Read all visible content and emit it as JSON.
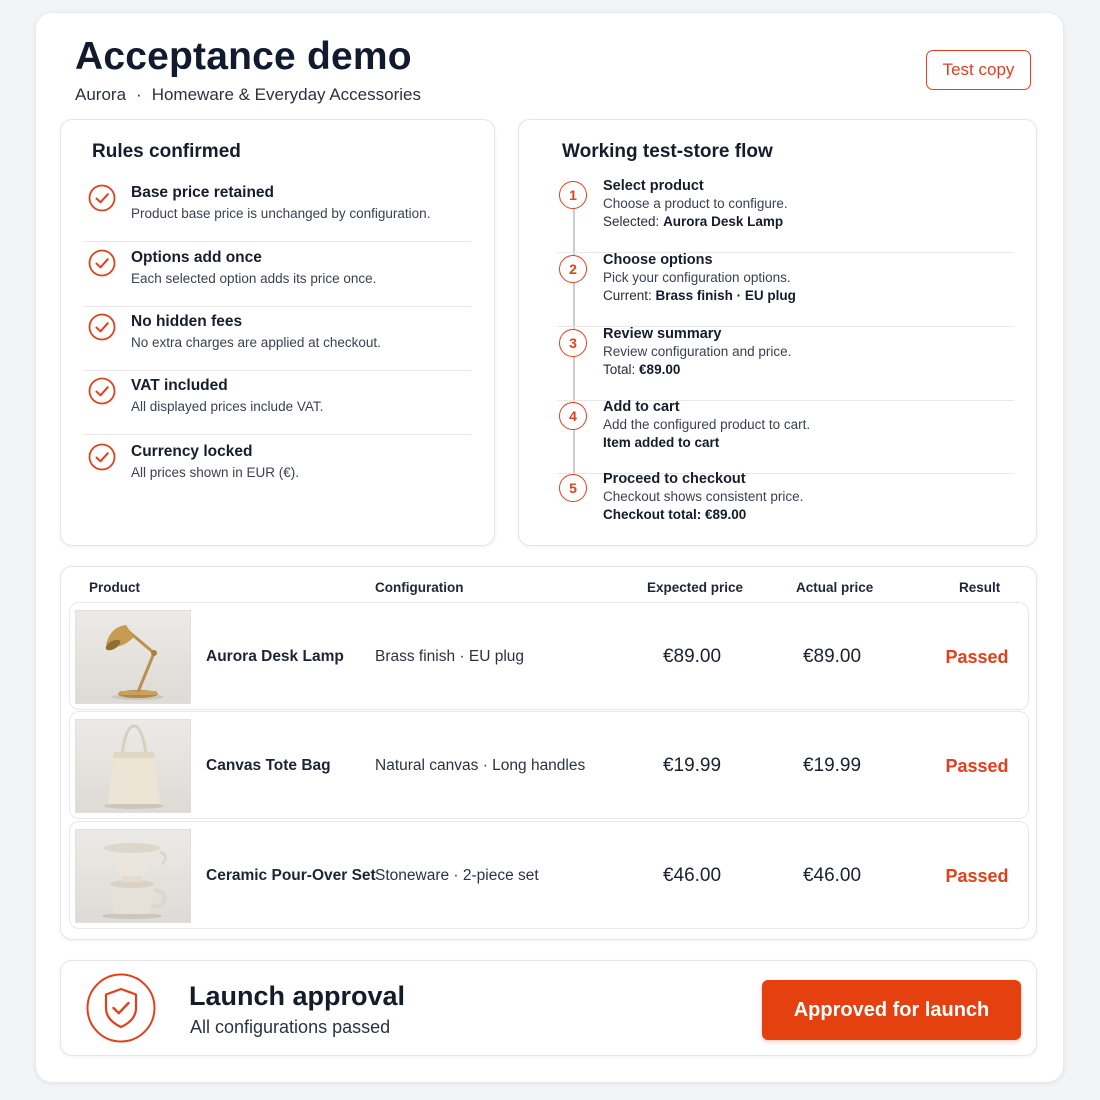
{
  "header": {
    "title": "Acceptance demo",
    "store": "Aurora",
    "separator": "·",
    "category": "Homeware & Everyday Accessories",
    "test_copy_label": "Test copy"
  },
  "rules": {
    "title": "Rules confirmed",
    "items": [
      {
        "title": "Base price retained",
        "desc": "Product base price is unchanged by configuration."
      },
      {
        "title": "Options add once",
        "desc": "Each selected option adds its price once."
      },
      {
        "title": "No hidden fees",
        "desc": "No extra charges are applied at checkout."
      },
      {
        "title": "VAT included",
        "desc": "All displayed prices include VAT."
      },
      {
        "title": "Currency locked",
        "desc": "All prices shown in EUR (€)."
      }
    ]
  },
  "flow": {
    "title": "Working test-store flow",
    "steps": [
      {
        "num": "1",
        "title": "Select product",
        "desc": "Choose a product to configure.",
        "detail_label": "Selected:",
        "detail_value": "Aurora Desk Lamp"
      },
      {
        "num": "2",
        "title": "Choose options",
        "desc": "Pick your configuration options.",
        "detail_label": "Current:",
        "detail_value": "Brass finish · EU plug"
      },
      {
        "num": "3",
        "title": "Review summary",
        "desc": "Review configuration and price.",
        "detail_label": "Total:",
        "detail_value": "€89.00"
      },
      {
        "num": "4",
        "title": "Add to cart",
        "desc": "Add the configured product to cart.",
        "detail_label": "",
        "detail_value": "Item added to cart"
      },
      {
        "num": "5",
        "title": "Proceed to checkout",
        "desc": "Checkout shows consistent price.",
        "detail_label": "",
        "detail_value": "Checkout total:  €89.00"
      }
    ]
  },
  "table": {
    "headers": {
      "product": "Product",
      "configuration": "Configuration",
      "expected": "Expected price",
      "actual": "Actual price",
      "result": "Result"
    },
    "rows": [
      {
        "name": "Aurora Desk Lamp",
        "config": "Brass finish · EU plug",
        "expected": "€89.00",
        "actual": "€89.00",
        "result": "Passed",
        "image": "desk-lamp"
      },
      {
        "name": "Canvas Tote Bag",
        "config": "Natural canvas · Long handles",
        "expected": "€19.99",
        "actual": "€19.99",
        "result": "Passed",
        "image": "tote-bag"
      },
      {
        "name": "Ceramic Pour-Over Set",
        "config": "Stoneware · 2-piece set",
        "expected": "€46.00",
        "actual": "€46.00",
        "result": "Passed",
        "image": "pour-over-set"
      }
    ]
  },
  "launch": {
    "title": "Launch approval",
    "subtitle": "All configurations passed",
    "button_label": "Approved for launch",
    "icon": "shield-check-icon"
  },
  "colors": {
    "accent": "#e2401c",
    "button": "#e5400f",
    "text": "#121a2d"
  }
}
